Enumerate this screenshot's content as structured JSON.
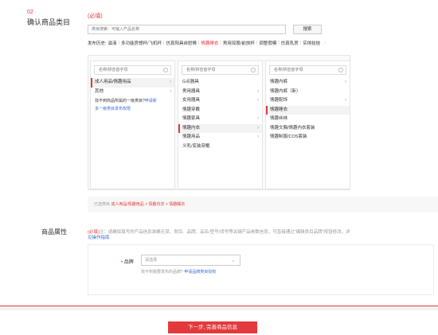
{
  "step": {
    "number": "02",
    "title": "确认商品类目",
    "required": "(必填)"
  },
  "search": {
    "placeholder": "类目搜索：可输入产品名称",
    "button": "搜索"
  },
  "history": {
    "label": "发布历史:",
    "items": [
      {
        "label": "滋液",
        "active": false
      },
      {
        "label": "多功能房想杯/飞机杯",
        "active": false
      },
      {
        "label": "仿真阳具自慰棒",
        "active": false
      },
      {
        "label": "情趣睡衣",
        "active": true
      },
      {
        "label": "男用双股/前放杯",
        "active": false
      },
      {
        "label": "调整假模",
        "active": false
      },
      {
        "label": "仿真乳房",
        "active": false
      },
      {
        "label": "实体娃娃",
        "active": false
      }
    ],
    "more": "‹"
  },
  "columns": [
    {
      "placeholder": "名称/拼音首字母",
      "options": [
        {
          "label": "成人用品/情趣用品",
          "has_children": true,
          "selected": true
        },
        {
          "label": "其他",
          "has_children": true,
          "selected": false
        }
      ],
      "hint_text": "找不到商品所属的一级类目?",
      "hint_link": "申请新",
      "hint2": "多一级类目发布权限"
    },
    {
      "placeholder": "名称/拼音首字母",
      "options": [
        {
          "label": "G点器具",
          "has_children": false,
          "selected": false
        },
        {
          "label": "男用器具",
          "has_children": true,
          "selected": false
        },
        {
          "label": "女用器具",
          "has_children": true,
          "selected": false
        },
        {
          "label": "情趣穿戴",
          "has_children": false,
          "selected": false
        },
        {
          "label": "情趣家具",
          "has_children": true,
          "selected": false
        },
        {
          "label": "情趣内衣",
          "has_children": true,
          "selected": true
        },
        {
          "label": "情趣用品",
          "has_children": true,
          "selected": false
        },
        {
          "label": "义乳/变装穿戴",
          "has_children": false,
          "selected": false
        }
      ]
    },
    {
      "placeholder": "名称/拼音首字母",
      "options": [
        {
          "label": "情趣内裤",
          "has_children": true,
          "selected": false
        },
        {
          "label": "情趣内裤（新）",
          "has_children": false,
          "selected": false
        },
        {
          "label": "情趣配饰",
          "has_children": true,
          "selected": false
        },
        {
          "label": "情趣睡衣",
          "has_children": false,
          "selected": true
        },
        {
          "label": "情趣丝袜",
          "has_children": false,
          "selected": false
        },
        {
          "label": "情趣文胸/情趣内衣套装",
          "has_children": false,
          "selected": false
        },
        {
          "label": "情趣制服/COS套装",
          "has_children": false,
          "selected": false
        }
      ]
    }
  ],
  "selected": {
    "label": "已选类目",
    "path": "成人用品/情趣用品 > 情趣内衣 > 情趣睡衣"
  },
  "attributes": {
    "label": "商品属性",
    "required": "(必填)",
    "note": "注：请确保填写的产品信息准确无误，类目、品牌、品名/型号/货号等关键产品参数信息，可直接通过\"编辑类目品牌\"按钮修改，详",
    "note_link": "见操作指南",
    "brand_label": "品牌",
    "brand_placeholder": "请选择",
    "brand_hint": "找不到我要发布的品牌?",
    "brand_hint_link": "申请品牌类目授权"
  },
  "footer": {
    "next_label": "下一步, 完善商品信息"
  },
  "colors": {
    "accent": "#e4393c",
    "link": "#3a6ad1"
  }
}
